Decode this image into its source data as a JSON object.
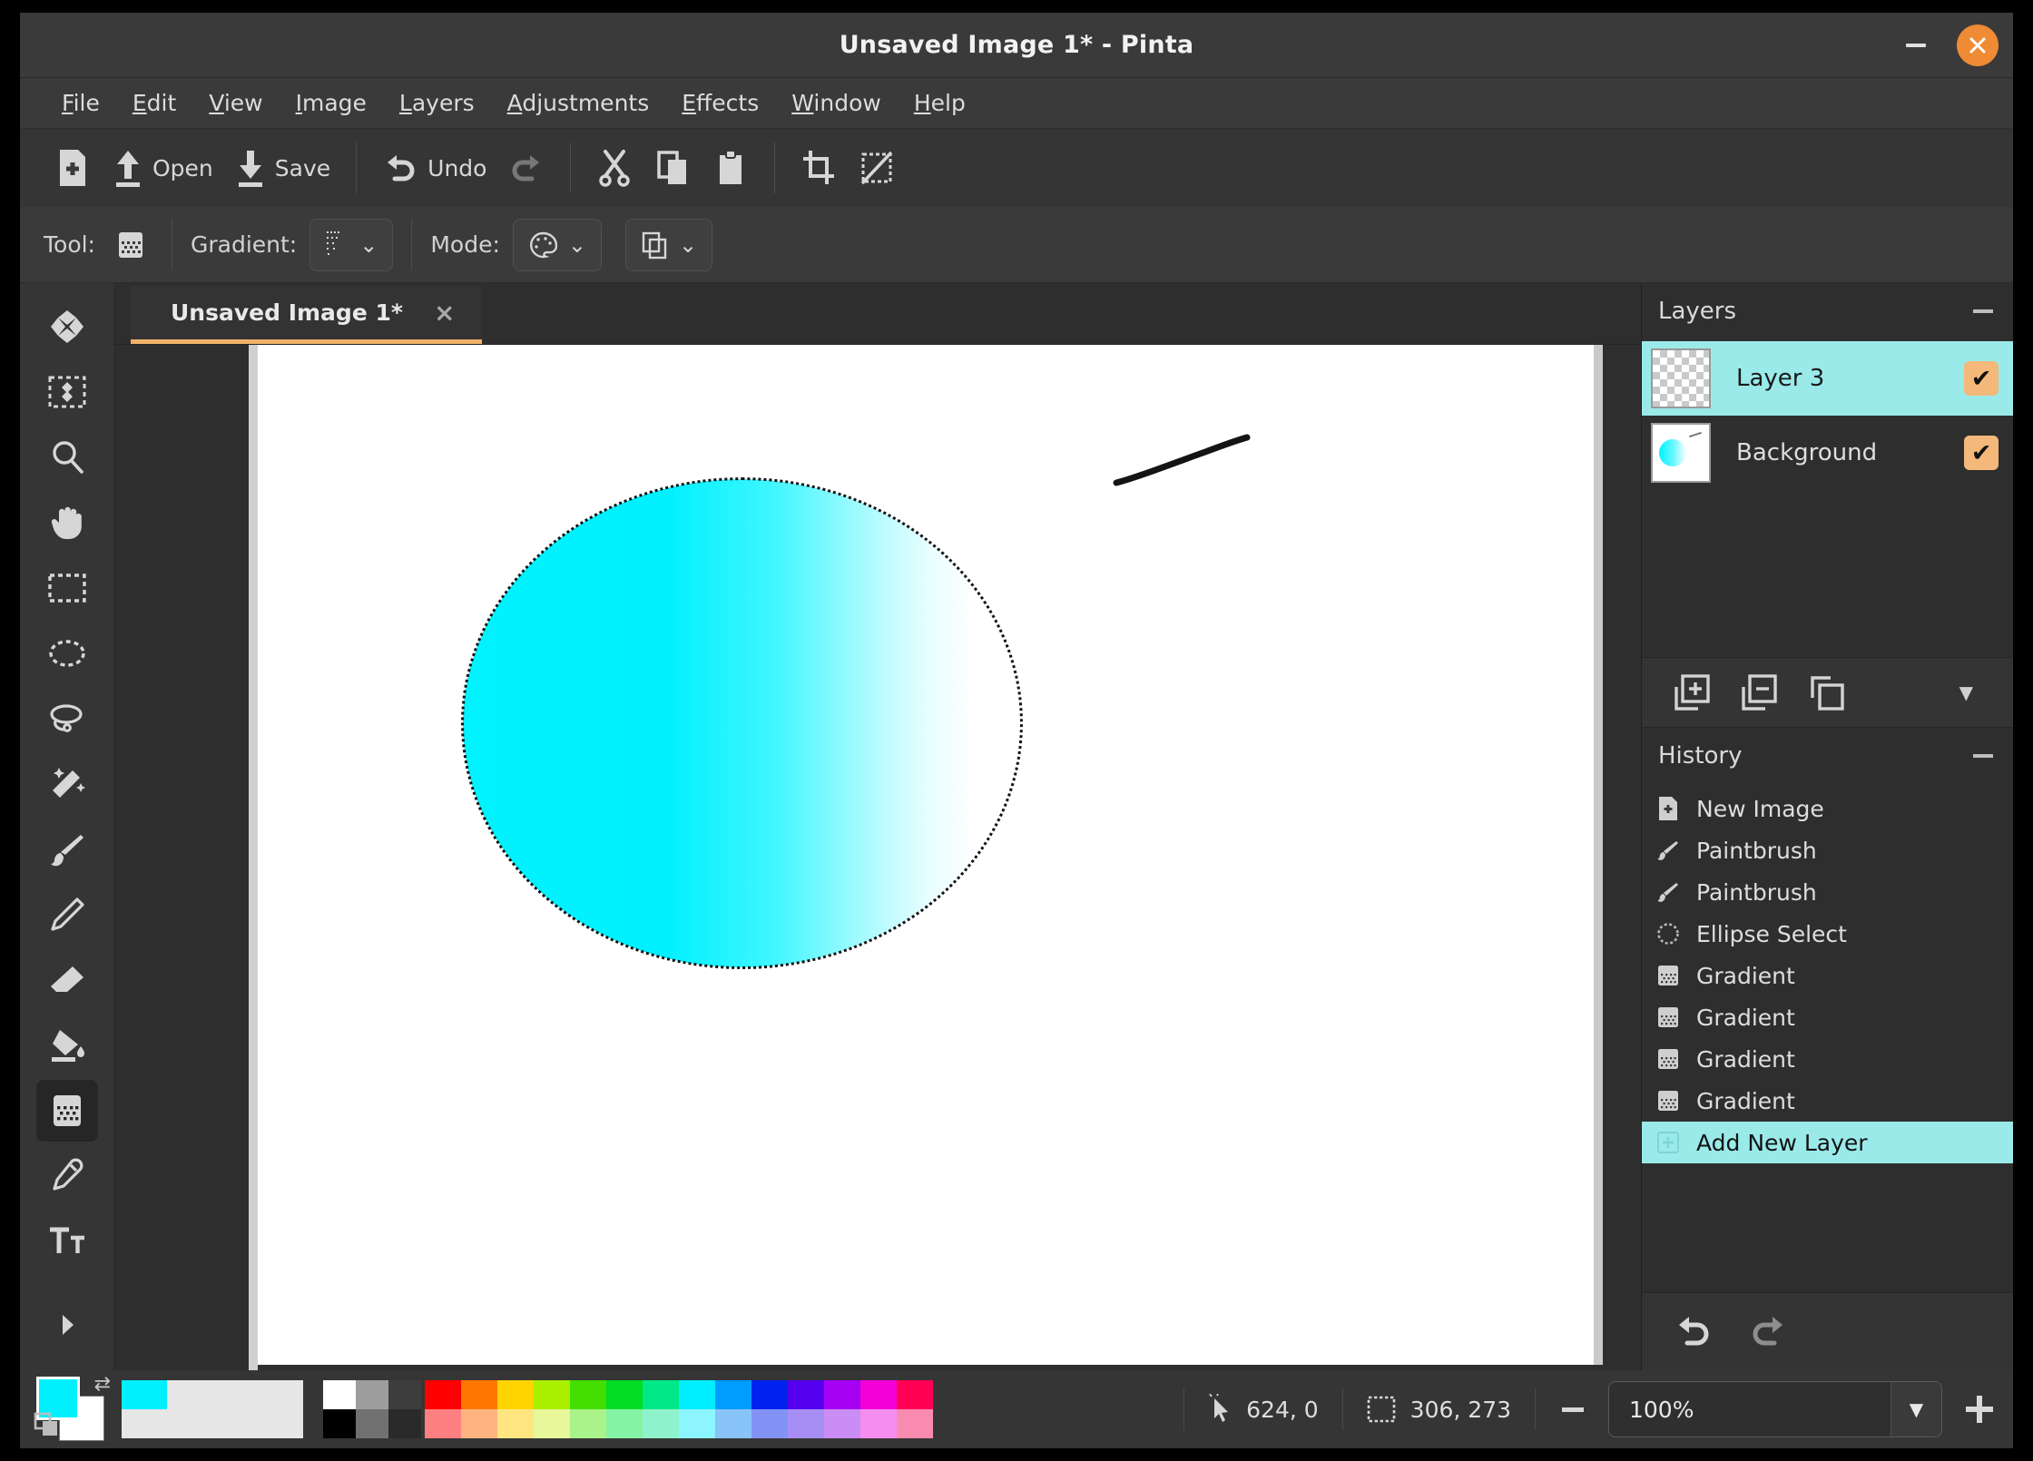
{
  "window": {
    "title": "Unsaved Image 1* - Pinta",
    "minimize_label": "minimize",
    "close_label": "close"
  },
  "menubar": {
    "items": [
      {
        "label": "File",
        "mnemonic": "F"
      },
      {
        "label": "Edit",
        "mnemonic": "E"
      },
      {
        "label": "View",
        "mnemonic": "V"
      },
      {
        "label": "Image",
        "mnemonic": "I"
      },
      {
        "label": "Layers",
        "mnemonic": "L"
      },
      {
        "label": "Adjustments",
        "mnemonic": "A"
      },
      {
        "label": "Effects",
        "mnemonic": "E"
      },
      {
        "label": "Window",
        "mnemonic": "W"
      },
      {
        "label": "Help",
        "mnemonic": "H"
      }
    ]
  },
  "toolbar": {
    "new_label": "",
    "open_label": "Open",
    "save_label": "Save",
    "undo_label": "Undo",
    "redo_label": "",
    "icons": [
      "new-image-icon",
      "open-icon",
      "save-icon",
      "undo-icon",
      "redo-icon",
      "cut-icon",
      "copy-icon",
      "paste-icon",
      "crop-to-selection-icon",
      "deselect-all-icon"
    ]
  },
  "tool_options": {
    "tool_label": "Tool:",
    "tool_icon": "gradient-tool-icon",
    "gradient_label": "Gradient:",
    "gradient_value_icon": "linear-gradient-icon",
    "mode_label": "Mode:",
    "mode_value_icon": "color-mode-palette-icon",
    "blend_value_icon": "blend-mode-icon"
  },
  "tools": [
    {
      "name": "move-selected-tool",
      "icon": "move-arrows-icon"
    },
    {
      "name": "move-selection-tool",
      "icon": "move-selection-icon"
    },
    {
      "name": "zoom-tool",
      "icon": "magnifier-icon"
    },
    {
      "name": "pan-tool",
      "icon": "hand-icon"
    },
    {
      "name": "rectangle-select-tool",
      "icon": "rectangle-select-icon"
    },
    {
      "name": "ellipse-select-tool",
      "icon": "ellipse-select-icon"
    },
    {
      "name": "lasso-select-tool",
      "icon": "lasso-icon"
    },
    {
      "name": "magic-wand-tool",
      "icon": "magic-wand-icon"
    },
    {
      "name": "paintbrush-tool",
      "icon": "paintbrush-icon"
    },
    {
      "name": "pencil-tool",
      "icon": "pencil-icon"
    },
    {
      "name": "eraser-tool",
      "icon": "eraser-icon"
    },
    {
      "name": "paint-bucket-tool",
      "icon": "paint-bucket-icon"
    },
    {
      "name": "gradient-tool",
      "icon": "gradient-icon",
      "active": true
    },
    {
      "name": "color-picker-tool",
      "icon": "eyedropper-icon"
    },
    {
      "name": "text-tool",
      "icon": "text-icon"
    }
  ],
  "tools_more_label": "more-tools-arrow-icon",
  "document": {
    "tab_label": "Unsaved Image 1*",
    "tab_close_label": "×",
    "canvas": {
      "selection_shape": "ellipse",
      "gradient_from": "#00f0ff",
      "gradient_to": "#ffffff",
      "stroke_color": "#111111"
    }
  },
  "layers_panel": {
    "title": "Layers",
    "collapse_label": "collapse",
    "rows": [
      {
        "name": "Layer 3",
        "visible": true,
        "selected": true,
        "thumb": "transparent-checker"
      },
      {
        "name": "Background",
        "visible": true,
        "selected": false,
        "thumb": "gradient-ellipse"
      }
    ],
    "checkmark": "✔",
    "actions": [
      {
        "name": "add-layer-button",
        "icon": "layer-plus-icon"
      },
      {
        "name": "remove-layer-button",
        "icon": "layer-minus-icon"
      },
      {
        "name": "duplicate-layer-button",
        "icon": "layer-copy-icon"
      },
      {
        "name": "layer-menu-button",
        "icon": "caret-down-icon"
      }
    ]
  },
  "history_panel": {
    "title": "History",
    "collapse_label": "collapse",
    "items": [
      {
        "label": "New Image",
        "icon": "new-image-icon",
        "selected": false
      },
      {
        "label": "Paintbrush",
        "icon": "paintbrush-icon",
        "selected": false
      },
      {
        "label": "Paintbrush",
        "icon": "paintbrush-icon",
        "selected": false
      },
      {
        "label": "Ellipse Select",
        "icon": "ellipse-select-icon",
        "selected": false
      },
      {
        "label": "Gradient",
        "icon": "gradient-icon",
        "selected": false
      },
      {
        "label": "Gradient",
        "icon": "gradient-icon",
        "selected": false
      },
      {
        "label": "Gradient",
        "icon": "gradient-icon",
        "selected": false
      },
      {
        "label": "Gradient",
        "icon": "gradient-icon",
        "selected": false
      },
      {
        "label": "Add New Layer",
        "icon": "add-layer-icon",
        "selected": true
      }
    ],
    "actions": [
      {
        "name": "history-undo-button",
        "icon": "undo-icon",
        "enabled": true
      },
      {
        "name": "history-redo-button",
        "icon": "redo-icon",
        "enabled": false
      }
    ]
  },
  "statusbar": {
    "primary_color": "#00f0ff",
    "secondary_color": "#ffffff",
    "recent_color": "#00f0ff",
    "cursor_icon": "cursor-position-icon",
    "cursor_position": "624, 0",
    "selection_icon": "selection-size-icon",
    "selection_size": "306, 273",
    "zoom_out_label": "−",
    "zoom_value": "100%",
    "zoom_in_label": "+",
    "zoom_caret": "▼",
    "gray_swatches": [
      [
        "#ffffff",
        "#9d9d9d",
        "#3d3d3d"
      ],
      [
        "#000000",
        "#717171",
        "#2a2a2a"
      ]
    ],
    "palette_swatches": [
      [
        "#ff0000",
        "#ff7700",
        "#ffd400",
        "#aaee00",
        "#44dd00",
        "#00dd22",
        "#00e888",
        "#00eeff",
        "#009cff",
        "#0022ee",
        "#5500ee",
        "#a600f2",
        "#f200d5",
        "#ff0055"
      ],
      [
        "#ff8080",
        "#ffb380",
        "#ffe680",
        "#e8f79a",
        "#aaf28a",
        "#85f3a4",
        "#8ef3cd",
        "#8df5ff",
        "#88c4f7",
        "#8393f5",
        "#a78ef5",
        "#ca8df5",
        "#f58df0",
        "#f98ab0"
      ]
    ]
  }
}
